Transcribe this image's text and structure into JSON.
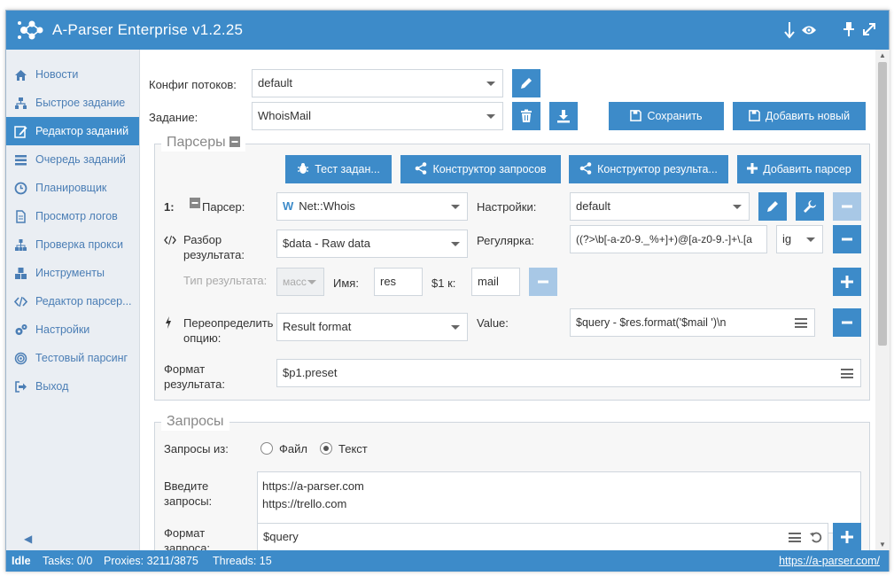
{
  "app": {
    "title": "A-Parser Enterprise v1.2.25"
  },
  "sidebar": {
    "items": [
      {
        "label": "Новости",
        "icon": "home-icon"
      },
      {
        "label": "Быстрое задание",
        "icon": "sitemap-icon"
      },
      {
        "label": "Редактор заданий",
        "icon": "edit-icon",
        "active": true
      },
      {
        "label": "Очередь заданий",
        "icon": "list-icon"
      },
      {
        "label": "Планировщик",
        "icon": "clock-icon"
      },
      {
        "label": "Просмотр логов",
        "icon": "file-icon"
      },
      {
        "label": "Проверка прокси",
        "icon": "network-icon"
      },
      {
        "label": "Инструменты",
        "icon": "cubes-icon"
      },
      {
        "label": "Редактор парсер...",
        "icon": "code-icon"
      },
      {
        "label": "Настройки",
        "icon": "gears-icon"
      },
      {
        "label": "Тестовый парсинг",
        "icon": "target-icon"
      },
      {
        "label": "Выход",
        "icon": "exit-icon"
      }
    ]
  },
  "top": {
    "threads_label": "Конфиг потоков:",
    "threads_value": "default",
    "task_label": "Задание:",
    "task_value": "WhoisMail",
    "save_label": "Сохранить",
    "add_new_label": "Добавить новый"
  },
  "parsers": {
    "legend": "Парсеры",
    "test_button": "Тест задан...",
    "query_builder_button": "Конструктор запросов",
    "result_builder_button": "Конструктор результа...",
    "add_parser_button": "Добавить парсер",
    "index": "1:",
    "parser_label": "Парсер:",
    "parser_value": "Net::Whois",
    "parser_logo": "W",
    "settings_label": "Настройки:",
    "settings_value": "default",
    "parse_result_label": "Разбор результата:",
    "parse_result_value": "$data - Raw data",
    "regex_label": "Регулярка:",
    "regex_value": "((?>\\b[-a-z0-9._%+]+)@[a-z0-9.-]+\\.[a",
    "regex_flags": "ig",
    "result_type_label": "Тип результата:",
    "result_type_value": "масс",
    "name_label": "Имя:",
    "name_value": "res",
    "group_label": "$1 к:",
    "group_value": "mail",
    "override_label": "Переопределить опцию:",
    "override_value": "Result format",
    "value_label": "Value:",
    "value_value": "$query - $res.format('$mail ')\\n",
    "result_format_label": "Формат результата:",
    "result_format_value": "$p1.preset"
  },
  "queries": {
    "legend": "Запросы",
    "from_label": "Запросы из:",
    "option_file": "Файл",
    "option_text": "Текст",
    "selected": "Текст",
    "enter_label": "Введите запросы:",
    "lines": [
      "https://a-parser.com",
      "https://trello.com"
    ],
    "format_label": "Формат запроса:",
    "format_value": "$query"
  },
  "status": {
    "state": "Idle",
    "tasks": "Tasks: 0/0",
    "proxies": "Proxies: 3211/3875",
    "threads": "Threads: 15",
    "link": "https://a-parser.com/"
  },
  "colors": {
    "accent": "#3d8bc9",
    "accent_light": "#a8c8e6",
    "sidebar_bg": "#eaeef3",
    "sidebar_text": "#4b7eb5"
  }
}
